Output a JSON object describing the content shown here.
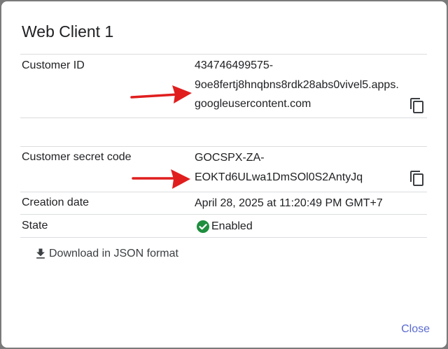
{
  "dialog": {
    "title": "Web Client 1"
  },
  "fields": {
    "customer_id": {
      "label": "Customer ID",
      "lines": [
        "434746499575-",
        "9oe8fertj8hnqbns8rdk28abs0vivel5.apps.",
        "googleusercontent.com"
      ]
    },
    "secret": {
      "label": "Customer secret code",
      "lines": [
        "GOCSPX-ZA-",
        "EOKTd6ULwa1DmSOl0S2AntyJq"
      ]
    },
    "creation_date": {
      "label": "Creation date",
      "value": "April 28, 2025 at 11:20:49 PM GMT+7"
    },
    "state": {
      "label": "State",
      "value": "Enabled"
    }
  },
  "actions": {
    "download_label": "Download in JSON format",
    "close_label": "Close"
  },
  "colors": {
    "accent": "#5a6acf",
    "success": "#1e8e3e",
    "arrow": "#e01e1e",
    "divider": "#dadce0"
  }
}
